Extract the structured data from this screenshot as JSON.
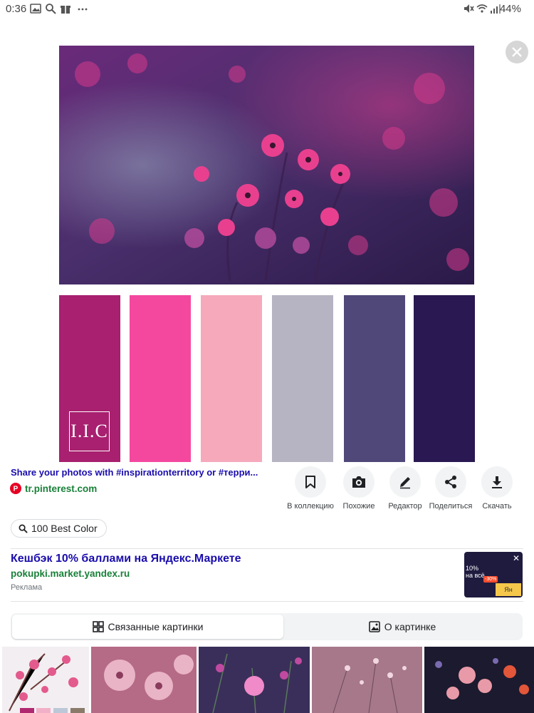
{
  "status_bar": {
    "time": "0:36",
    "battery": "44%",
    "left_icons": [
      "image-icon",
      "search-icon",
      "gift-icon",
      "more-dots-icon"
    ],
    "right_icons": [
      "mute-icon",
      "wifi-icon",
      "signal-icon"
    ]
  },
  "viewer": {
    "close_icon": "close-icon",
    "palette": [
      "#a8206f",
      "#f4489f",
      "#f5a9bb",
      "#b6b4c3",
      "#4f4878",
      "#291851"
    ],
    "logo_text": "I.I.C"
  },
  "result": {
    "title": "Share your photos with #inspirationterritory or #терри...",
    "source": "tr.pinterest.com"
  },
  "actions": [
    {
      "label": "В коллекцию",
      "icon": "bookmark-icon"
    },
    {
      "label": "Похожие",
      "icon": "lens-camera-icon"
    },
    {
      "label": "Редактор",
      "icon": "pencil-icon"
    },
    {
      "label": "Поделиться",
      "icon": "share-icon"
    },
    {
      "label": "Скачать",
      "icon": "download-icon"
    }
  ],
  "search_chip": {
    "label": "100 Best Color"
  },
  "ad": {
    "title": "Кешбэк 10% баллами на Яндекс.Маркете",
    "url": "pokupki.market.yandex.ru",
    "label": "Реклама",
    "thumb_lines": [
      "10%",
      "на всё"
    ],
    "thumb_badge": "-30%",
    "thumb_brand": "Ян"
  },
  "tabs": [
    {
      "label": "Связанные картинки",
      "icon": "grid-icon",
      "active": true
    },
    {
      "label": "О картинке",
      "icon": "image-icon",
      "active": false
    }
  ],
  "colors": {
    "link_blue": "#1a0dab",
    "url_green": "#188038",
    "pinterest_red": "#e60023"
  }
}
